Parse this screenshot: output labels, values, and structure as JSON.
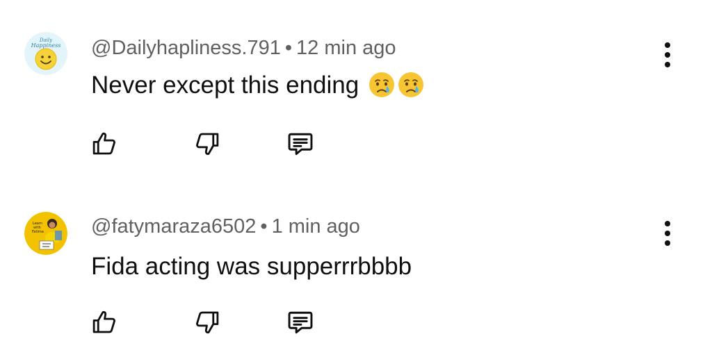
{
  "comments": [
    {
      "author": "@Dailyhapliness.791",
      "time": "12 min ago",
      "separator": "•",
      "text": "Never except this ending",
      "emojis": [
        "crying-face",
        "crying-face"
      ],
      "avatar": {
        "logo_text": "Daily Happiness",
        "bg": "#e6f6fb",
        "face_color": "#f6d23a"
      }
    },
    {
      "author": "@fatymaraza6502",
      "time": "1 min ago",
      "separator": "•",
      "text": "Fida acting was supperrrbbbb",
      "emojis": [],
      "avatar": {
        "logo_text": "Learn with Fatima",
        "bg": "#f2c200"
      }
    }
  ],
  "actions": {
    "like_icon": "thumbs-up-icon",
    "dislike_icon": "thumbs-down-icon",
    "reply_icon": "reply-comment-icon",
    "more_icon": "more-vert-icon"
  },
  "colors": {
    "meta": "#606060",
    "text": "#0f0f0f",
    "background": "#ffffff"
  }
}
